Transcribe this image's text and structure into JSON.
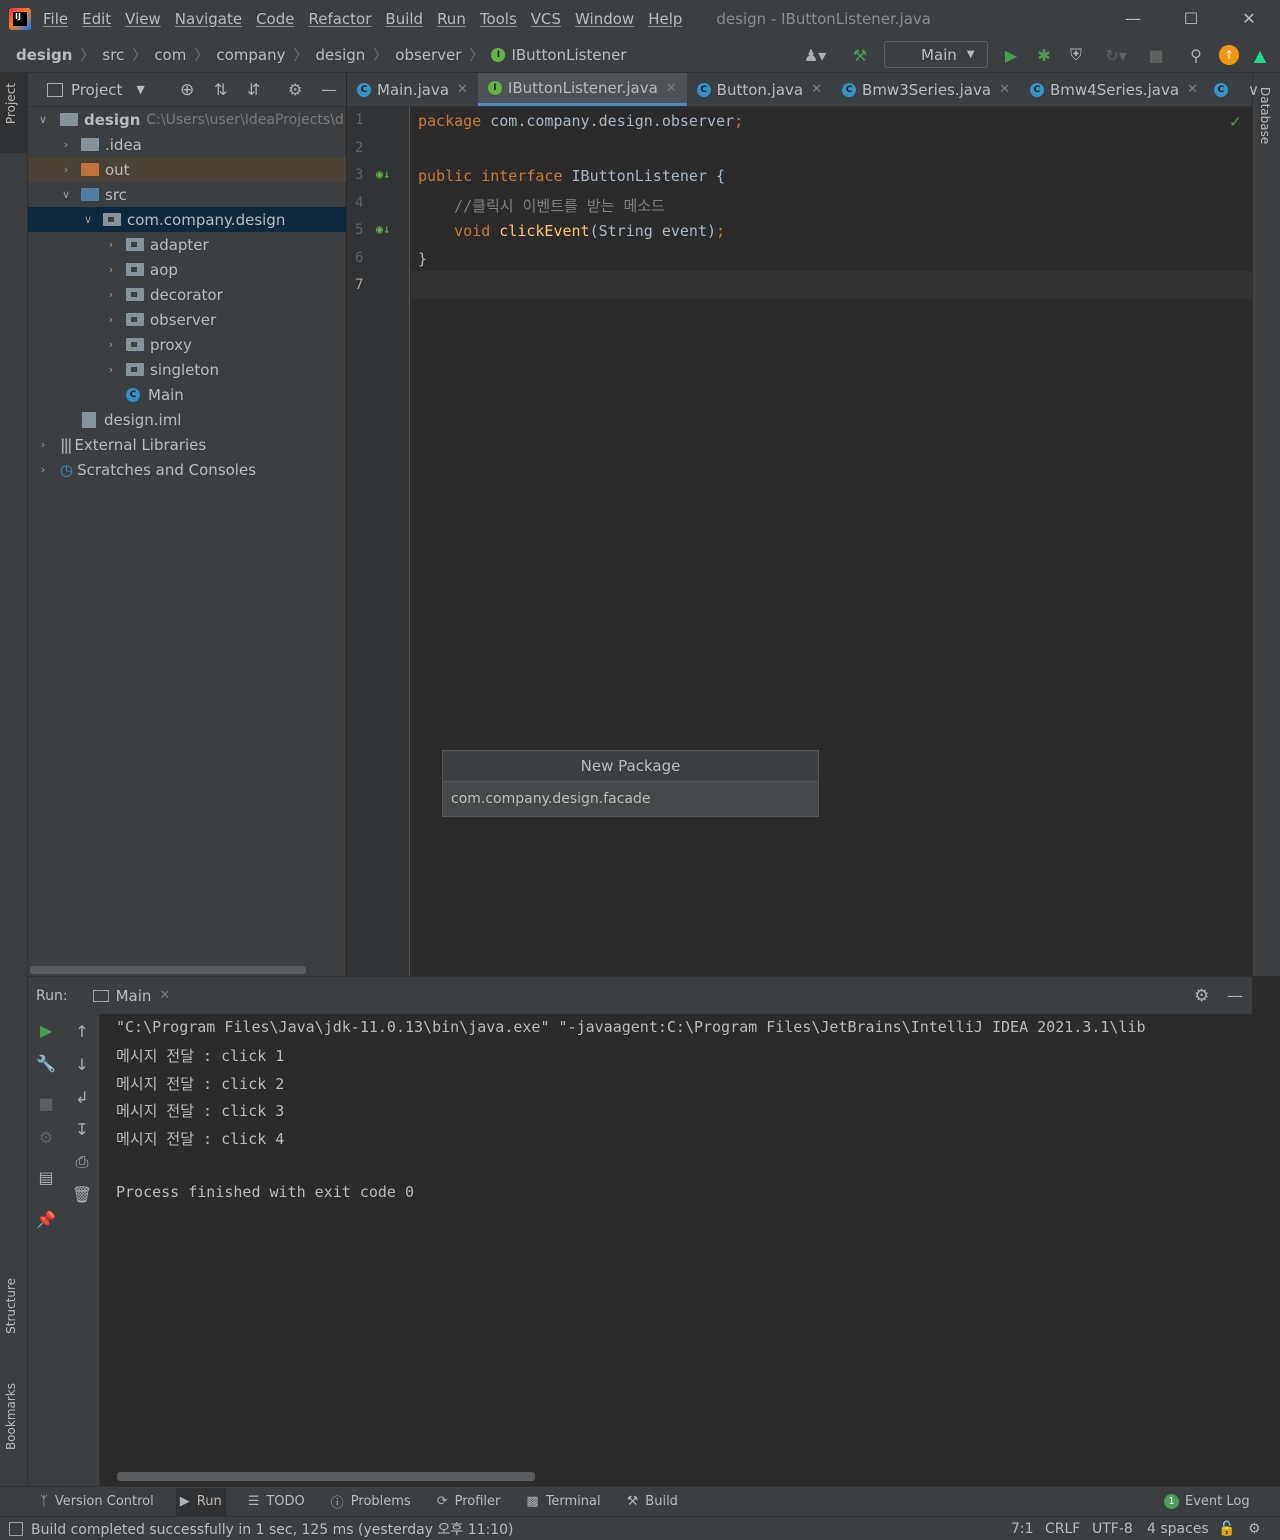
{
  "app": {
    "logo_text": "IJ",
    "window_title": "design - IButtonListener.java"
  },
  "menu": [
    "File",
    "Edit",
    "View",
    "Navigate",
    "Code",
    "Refactor",
    "Build",
    "Run",
    "Tools",
    "VCS",
    "Window",
    "Help"
  ],
  "breadcrumbs": [
    "design",
    "src",
    "com",
    "company",
    "design",
    "observer",
    "IButtonListener"
  ],
  "run_config": "Main",
  "project": {
    "header": "Project",
    "tree": [
      {
        "label": "design",
        "hint": "C:\\Users\\user\\IdeaProjects\\d"
      },
      {
        "label": ".idea"
      },
      {
        "label": "out"
      },
      {
        "label": "src"
      },
      {
        "label": "com.company.design"
      },
      {
        "label": "adapter"
      },
      {
        "label": "aop"
      },
      {
        "label": "decorator"
      },
      {
        "label": "observer"
      },
      {
        "label": "proxy"
      },
      {
        "label": "singleton"
      },
      {
        "label": "Main"
      },
      {
        "label": "design.iml"
      },
      {
        "label": "External Libraries"
      },
      {
        "label": "Scratches and Consoles"
      }
    ]
  },
  "tabs": [
    {
      "label": "Main.java"
    },
    {
      "label": "IButtonListener.java"
    },
    {
      "label": "Button.java"
    },
    {
      "label": "Bmw3Series.java"
    },
    {
      "label": "Bmw4Series.java"
    }
  ],
  "editor": {
    "line_numbers": [
      "1",
      "2",
      "3",
      "4",
      "5",
      "6",
      "7"
    ],
    "lines": {
      "l1_kw": "package",
      "l1_rest": " com.company.design.observer",
      "l3_kw1": "public",
      "l3_kw2": "interface",
      "l3_rest": " IButtonListener {",
      "l4_comment": "    //클릭시 이벤트를 받는 메소드",
      "l5_kw": "    void",
      "l5_fn": "clickEvent",
      "l5_rest": "(String event)",
      "l6": "}"
    }
  },
  "popup": {
    "title": "New Package",
    "value": "com.company.design.facade"
  },
  "run": {
    "label": "Run:",
    "tab": "Main",
    "console": [
      "\"C:\\Program Files\\Java\\jdk-11.0.13\\bin\\java.exe\" \"-javaagent:C:\\Program Files\\JetBrains\\IntelliJ IDEA 2021.3.1\\lib",
      "메시지 전달 : click 1",
      "메시지 전달 : click 2",
      "메시지 전달 : click 3",
      "메시지 전달 : click 4",
      "",
      "Process finished with exit code 0"
    ]
  },
  "side_tabs": {
    "project": "Project",
    "structure": "Structure",
    "bookmarks": "Bookmarks",
    "database": "Database"
  },
  "bottom_tools": [
    "Version Control",
    "Run",
    "TODO",
    "Problems",
    "Profiler",
    "Terminal",
    "Build"
  ],
  "event_log": {
    "count": "1",
    "label": "Event Log"
  },
  "status": {
    "message": "Build completed successfully in 1 sec, 125 ms (yesterday 오후 11:10)",
    "position": "7:1",
    "line_sep": "CRLF",
    "encoding": "UTF-8",
    "indent": "4 spaces"
  },
  "colors": {
    "accent": "#4a88c7",
    "selection": "#0d293e",
    "keyword": "#cc7832",
    "function": "#ffc66d",
    "comment": "#808080",
    "run_green": "#499c54"
  }
}
